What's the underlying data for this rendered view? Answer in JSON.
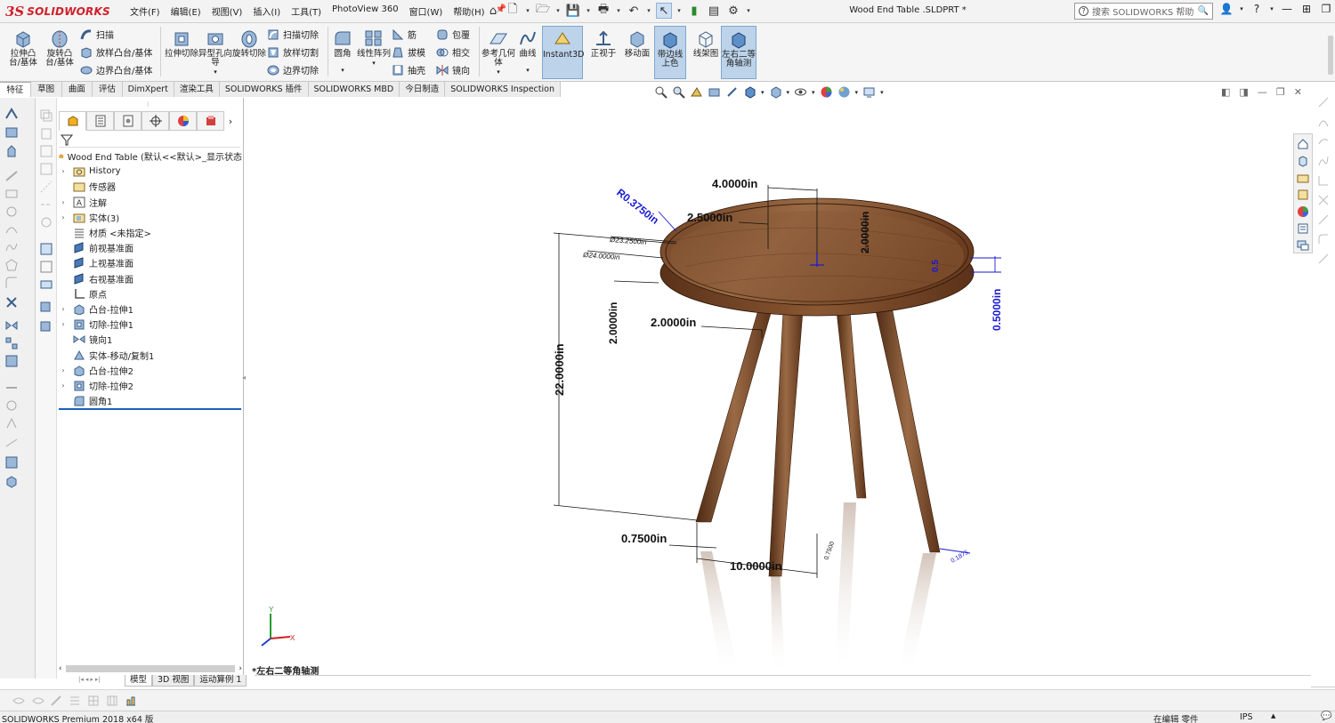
{
  "app": {
    "logo_prefix": "3S",
    "logo_name": "SOLIDWORKS",
    "document_title": "Wood End Table .SLDPRT *",
    "help_search_placeholder": "搜索 SOLIDWORKS 帮助"
  },
  "menu": [
    "文件(F)",
    "编辑(E)",
    "视图(V)",
    "插入(I)",
    "工具(T)",
    "PhotoView 360",
    "窗口(W)",
    "帮助(H)"
  ],
  "ribbon": {
    "extrude_boss": "拉伸凸台/基体",
    "revolve_boss": "旋转凸台/基体",
    "sweep": "扫描",
    "loft": "放样凸台/基体",
    "boundary_boss": "边界凸台/基体",
    "extrude_cut": "拉伸切除",
    "hole_wizard": "异型孔向导",
    "revolve_cut": "旋转切除",
    "swept_cut": "扫描切除",
    "lofted_cut": "放样切割",
    "boundary_cut": "边界切除",
    "fillet": "圆角",
    "linear_pattern": "线性阵列",
    "rib": "筋",
    "draft": "拔模",
    "shell": "抽壳",
    "wrap": "包覆",
    "intersect": "相交",
    "mirror": "镜向",
    "ref_geometry": "参考几何体",
    "curves": "曲线",
    "instant3d": "Instant3D",
    "normal_to": "正视于",
    "move_face": "移动面",
    "shaded_edges": "带边线上色",
    "wireframe": "线架图",
    "dimetric": "左右二等角轴测"
  },
  "tabs": [
    "特征",
    "草图",
    "曲面",
    "评估",
    "DimXpert",
    "渲染工具",
    "SOLIDWORKS 插件",
    "SOLIDWORKS MBD",
    "今日制造",
    "SOLIDWORKS Inspection"
  ],
  "feature_tree": {
    "root": "Wood End Table  (默认<<默认>_显示状态",
    "items": [
      {
        "label": "History",
        "expandable": true
      },
      {
        "label": "传感器",
        "expandable": false
      },
      {
        "label": "注解",
        "expandable": true
      },
      {
        "label": "实体(3)",
        "expandable": true
      },
      {
        "label": "材质 <未指定>",
        "expandable": false
      },
      {
        "label": "前视基准面",
        "expandable": false
      },
      {
        "label": "上视基准面",
        "expandable": false
      },
      {
        "label": "右视基准面",
        "expandable": false
      },
      {
        "label": "原点",
        "expandable": false
      },
      {
        "label": "凸台-拉伸1",
        "expandable": true
      },
      {
        "label": "切除-拉伸1",
        "expandable": true
      },
      {
        "label": "镜向1",
        "expandable": false
      },
      {
        "label": "实体-移动/复制1",
        "expandable": false
      },
      {
        "label": "凸台-拉伸2",
        "expandable": true
      },
      {
        "label": "切除-拉伸2",
        "expandable": true
      },
      {
        "label": "圆角1",
        "expandable": false
      }
    ]
  },
  "bottom_tabs": [
    "模型",
    "3D 视图",
    "运动算例 1"
  ],
  "view_name": "*左右二等角轴测",
  "status": {
    "product": "SOLIDWORKS Premium 2018 x64 版",
    "editing": "在编辑 零件",
    "units": "IPS"
  },
  "dimensions": {
    "top_width": "4.0000in",
    "fillet_radius": "R0.3750in",
    "inner_offset": "2.5000in",
    "vertical_2": "2.0000in",
    "dia_1": "Ø23.2500in",
    "dia_2": "Ø24.0000in",
    "edge_small": "0.5",
    "thickness": "0.5000in",
    "leg_spacing_v": "2.0000in",
    "leg_spacing_h": "2.0000in",
    "height": "22.0000in",
    "leg_width": "0.7500in",
    "leg_spread": "10.0000in",
    "small_dim": "0.7500",
    "foot_dim": "0.1875"
  },
  "colors": {
    "accent": "#1f5fb5",
    "dimension_blue": "#1a1ad0",
    "wood": "#7a4a2a"
  }
}
